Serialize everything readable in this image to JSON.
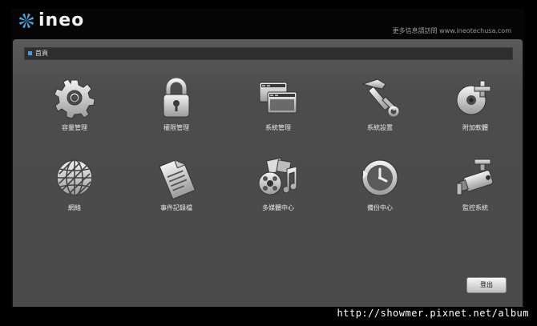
{
  "header": {
    "logo_text": "ineo",
    "tagline": "更多信息請訪問 www.ineotechusa.com"
  },
  "breadcrumb": {
    "label": "首頁"
  },
  "tiles": [
    {
      "label": "容量管理",
      "icon": "gear-icon"
    },
    {
      "label": "權限管理",
      "icon": "lock-icon"
    },
    {
      "label": "系統管理",
      "icon": "windows-icon"
    },
    {
      "label": "系統設置",
      "icon": "hammer-wrench-icon"
    },
    {
      "label": "附加軟體",
      "icon": "disc-plus-icon"
    },
    {
      "label": "網絡",
      "icon": "globe-icon"
    },
    {
      "label": "事件記錄檔",
      "icon": "document-icon"
    },
    {
      "label": "多媒體中心",
      "icon": "media-icon"
    },
    {
      "label": "備份中心",
      "icon": "backup-clock-icon"
    },
    {
      "label": "監控系統",
      "icon": "camera-icon"
    }
  ],
  "logout_label": "登出",
  "watermark": "http://showmer.pixnet.net/album"
}
